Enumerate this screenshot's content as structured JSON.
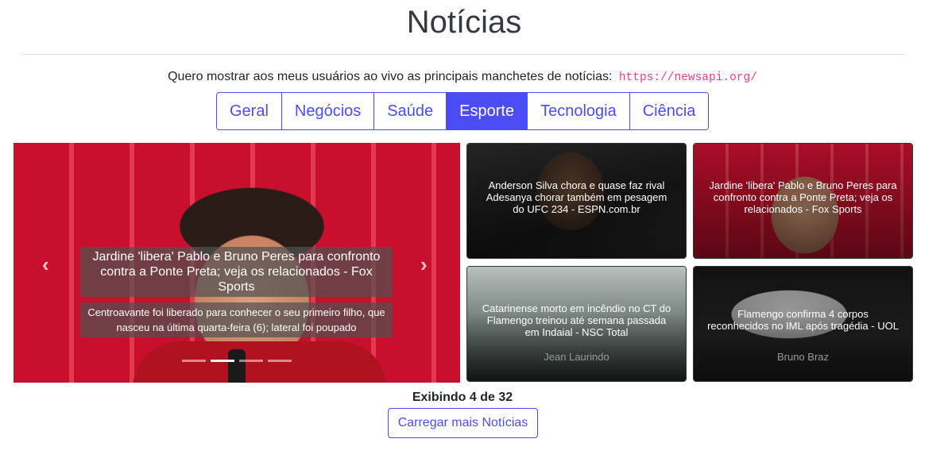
{
  "page": {
    "title": "Notícias",
    "intro_text": "Quero mostrar aos meus usuários ao vivo as principais manchetes de notícias:",
    "intro_link": "https://newsapi.org/"
  },
  "tabs": [
    {
      "label": "Geral",
      "active": false
    },
    {
      "label": "Negócios",
      "active": false
    },
    {
      "label": "Saúde",
      "active": false
    },
    {
      "label": "Esporte",
      "active": true
    },
    {
      "label": "Tecnologia",
      "active": false
    },
    {
      "label": "Ciência",
      "active": false
    }
  ],
  "carousel": {
    "title": "Jardine 'libera' Pablo e Bruno Peres para confronto contra a Ponte Preta; veja os relacionados - Fox Sports",
    "description": "Centroavante foi liberado para conhecer o seu primeiro filho, que nasceu na última quarta-feira (6); lateral foi poupado",
    "prev_icon": "‹",
    "next_icon": "›",
    "indicator_count": 4,
    "active_indicator": 1
  },
  "cards": [
    {
      "title": "Anderson Silva chora e quase faz rival Adesanya chorar também em pesagem do UFC 234 - ESPN.com.br",
      "author": ""
    },
    {
      "title": "Jardine 'libera' Pablo e Bruno Peres para confronto contra a Ponte Preta; veja os relacionados - Fox Sports",
      "author": ""
    },
    {
      "title": "Catarinense morto em incêndio no CT do Flamengo treinou até semana passada em Indaial - NSC Total",
      "author": "Jean Laurindo"
    },
    {
      "title": "Flamengo confirma 4 corpos reconhecidos no IML após tragédia - UOL",
      "author": "Bruno Braz"
    }
  ],
  "footer": {
    "showing": "Exibindo 4 de 32",
    "load_more": "Carregar mais Notícias"
  },
  "colors": {
    "accent": "#4c4cf5",
    "code": "#e83e8c"
  }
}
